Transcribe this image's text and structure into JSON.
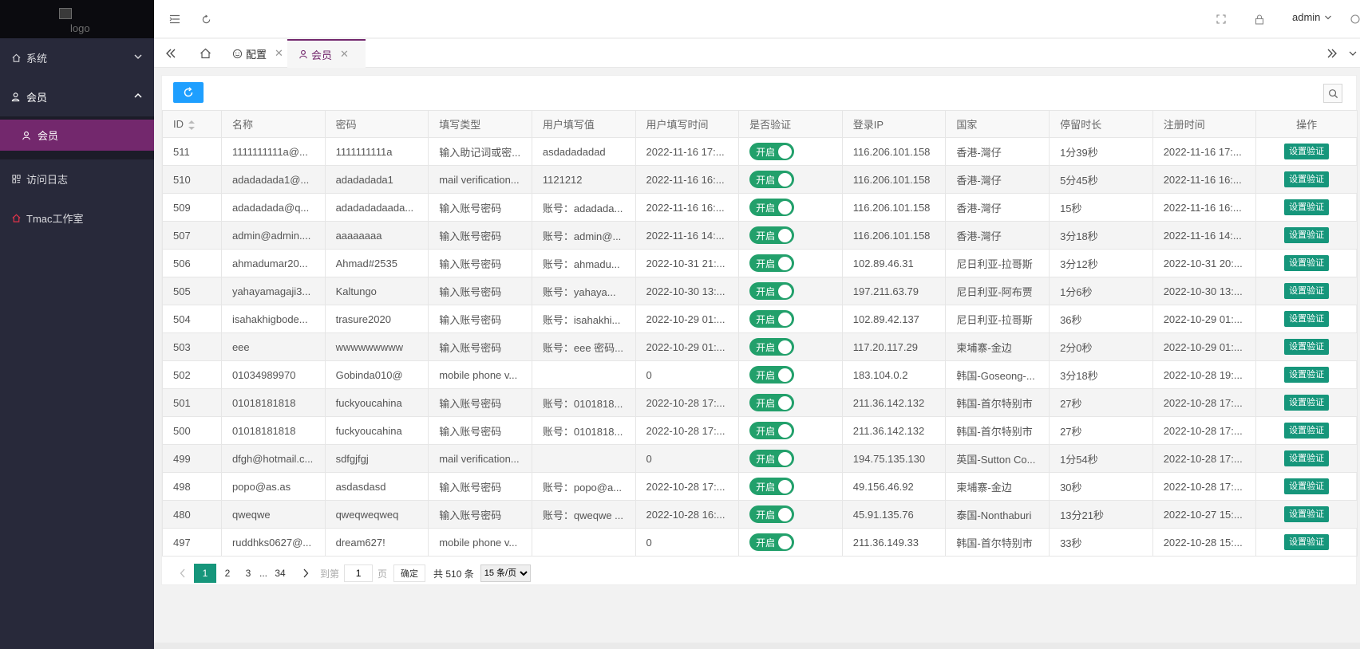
{
  "logo": {
    "alt": "logo"
  },
  "sidebar": {
    "items": [
      {
        "label": "系统"
      },
      {
        "label": "会员"
      },
      {
        "label": "会员"
      },
      {
        "label": "访问日志"
      },
      {
        "label": "Tmac工作室"
      }
    ]
  },
  "header": {
    "user": "admin"
  },
  "tabs": [
    {
      "label": "配置"
    },
    {
      "label": "会员"
    }
  ],
  "table": {
    "columns": [
      "ID",
      "名称",
      "密码",
      "填写类型",
      "用户填写值",
      "用户填写时间",
      "是否验证",
      "登录IP",
      "国家",
      "停留时长",
      "注册时间",
      "操作"
    ],
    "switch_label": "开启",
    "action_label": "设置验证",
    "rows": [
      [
        "511",
        "1111111111a@...",
        "1111111111a",
        "输入助记词或密...",
        "asdadadadad",
        "2022-11-16 17:...",
        "116.206.101.158",
        "香港-灣仔",
        "1分39秒",
        "2022-11-16 17:..."
      ],
      [
        "510",
        "adadadada1@...",
        "adadadada1",
        "mail verification...",
        "1121212",
        "2022-11-16 16:...",
        "116.206.101.158",
        "香港-灣仔",
        "5分45秒",
        "2022-11-16 16:..."
      ],
      [
        "509",
        "adadadada@q...",
        "adadadadaada...",
        "输入账号密码",
        "账号：adadada...",
        "2022-11-16 16:...",
        "116.206.101.158",
        "香港-灣仔",
        "15秒",
        "2022-11-16 16:..."
      ],
      [
        "507",
        "admin@admin....",
        "aaaaaaaa",
        "输入账号密码",
        "账号：admin@...",
        "2022-11-16 14:...",
        "116.206.101.158",
        "香港-灣仔",
        "3分18秒",
        "2022-11-16 14:..."
      ],
      [
        "506",
        "ahmadumar20...",
        "Ahmad#2535",
        "输入账号密码",
        "账号：ahmadu...",
        "2022-10-31 21:...",
        "102.89.46.31",
        "尼日利亚-拉哥斯",
        "3分12秒",
        "2022-10-31 20:..."
      ],
      [
        "505",
        "yahayamagaji3...",
        "Kaltungo",
        "输入账号密码",
        "账号：yahaya...",
        "2022-10-30 13:...",
        "197.211.63.79",
        "尼日利亚-阿布贾",
        "1分6秒",
        "2022-10-30 13:..."
      ],
      [
        "504",
        "isahakhigbode...",
        "trasure2020",
        "输入账号密码",
        "账号：isahakhi...",
        "2022-10-29 01:...",
        "102.89.42.137",
        "尼日利亚-拉哥斯",
        "36秒",
        "2022-10-29 01:..."
      ],
      [
        "503",
        "eee",
        "wwwwwwwww",
        "输入账号密码",
        "账号：eee 密码...",
        "2022-10-29 01:...",
        "117.20.117.29",
        "柬埔寨-金边",
        "2分0秒",
        "2022-10-29 01:..."
      ],
      [
        "502",
        "01034989970",
        "Gobinda010@",
        "mobile phone v...",
        "",
        "0",
        "183.104.0.2",
        "韩国-Goseong-...",
        "3分18秒",
        "2022-10-28 19:..."
      ],
      [
        "501",
        "01018181818",
        "fuckyoucahina",
        "输入账号密码",
        "账号：0101818...",
        "2022-10-28 17:...",
        "211.36.142.132",
        "韩国-首尔特别市",
        "27秒",
        "2022-10-28 17:..."
      ],
      [
        "500",
        "01018181818",
        "fuckyoucahina",
        "输入账号密码",
        "账号：0101818...",
        "2022-10-28 17:...",
        "211.36.142.132",
        "韩国-首尔特别市",
        "27秒",
        "2022-10-28 17:..."
      ],
      [
        "499",
        "dfgh@hotmail.c...",
        "sdfgjfgj",
        "mail verification...",
        "",
        "0",
        "194.75.135.130",
        "英国-Sutton Co...",
        "1分54秒",
        "2022-10-28 17:..."
      ],
      [
        "498",
        "popo@as.as",
        "asdasdasd",
        "输入账号密码",
        "账号：popo@a...",
        "2022-10-28 17:...",
        "49.156.46.92",
        "柬埔寨-金边",
        "30秒",
        "2022-10-28 17:..."
      ],
      [
        "480",
        "qweqwe",
        "qweqweqweq",
        "输入账号密码",
        "账号：qweqwe ...",
        "2022-10-28 16:...",
        "45.91.135.76",
        "泰国-Nonthaburi",
        "13分21秒",
        "2022-10-27 15:..."
      ],
      [
        "497",
        "ruddhks0627@...",
        "dream627!",
        "mobile phone v...",
        "",
        "0",
        "211.36.149.33",
        "韩国-首尔特别市",
        "33秒",
        "2022-10-28 15:..."
      ]
    ]
  },
  "pagination": {
    "current": "1",
    "pages": [
      "2",
      "3"
    ],
    "ellipsis": "...",
    "last": "34",
    "goto_label": "到第",
    "goto_value": "1",
    "page_unit": "页",
    "confirm": "确定",
    "total": "共 510 条",
    "per_page": "15 条/页"
  },
  "colors": {
    "sidebar": "#28293a",
    "accent": "#73286d",
    "switch": "#22a06b",
    "primary": "#1e9fff"
  }
}
